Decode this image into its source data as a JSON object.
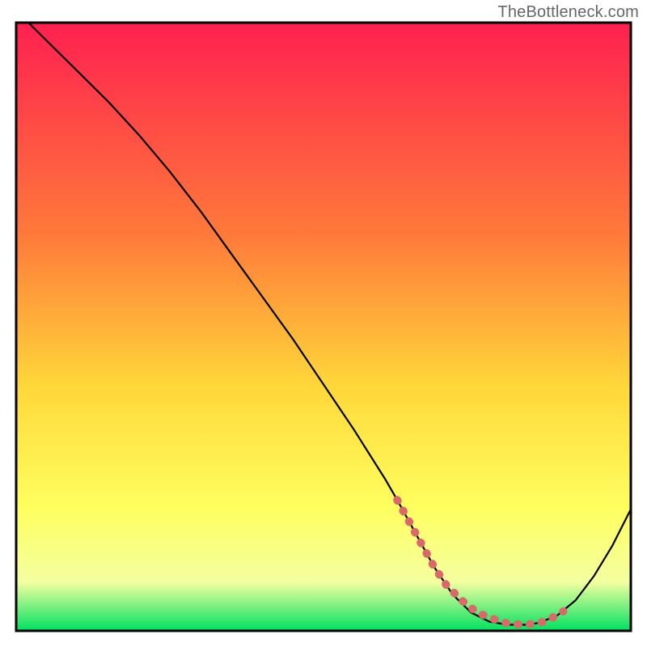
{
  "watermark": "TheBottleneck.com",
  "colors": {
    "grad_top": "#ff2050",
    "grad_mid1": "#ff7a3a",
    "grad_mid2": "#ffd83a",
    "grad_mid3": "#ffff60",
    "grad_mid4": "#f4ffa0",
    "grad_bottom": "#00e060",
    "curve": "#000000",
    "markers": "#d86a6a",
    "border": "#000000"
  },
  "chart_data": {
    "type": "line",
    "title": "",
    "xlabel": "",
    "ylabel": "",
    "xlim": [
      0,
      100
    ],
    "ylim": [
      0,
      100
    ],
    "curve": {
      "x": [
        2,
        6,
        10,
        15,
        20,
        25,
        30,
        35,
        40,
        45,
        50,
        55,
        60,
        62,
        65,
        68,
        71,
        74,
        77,
        80,
        83,
        85,
        88,
        91,
        94,
        97,
        100
      ],
      "y": [
        100,
        96,
        92,
        87,
        81.5,
        75.5,
        69,
        62,
        55,
        48,
        40.5,
        33,
        25,
        21.5,
        16,
        10.5,
        6,
        3,
        1.5,
        1,
        1,
        1.3,
        2.5,
        5,
        9,
        14,
        20
      ]
    },
    "marker_points": {
      "x": [
        62,
        65,
        68,
        70,
        72.5,
        75,
        77.5,
        80,
        82.5,
        85,
        87,
        89
      ],
      "y": [
        21.5,
        16,
        10.5,
        7.5,
        5,
        3,
        2,
        1.2,
        1,
        1.2,
        2,
        3.2
      ]
    }
  }
}
